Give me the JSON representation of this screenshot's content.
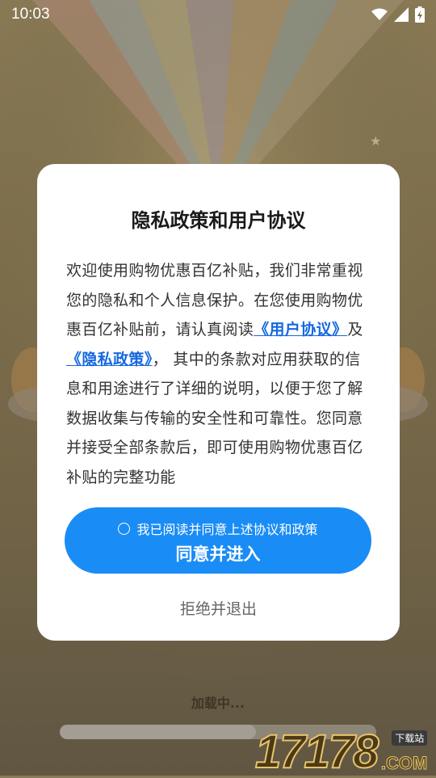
{
  "status_bar": {
    "time": "10:03",
    "icons": [
      "wifi-icon",
      "signal-icon",
      "battery-charging-icon"
    ]
  },
  "dialog": {
    "title": "隐私政策和用户协议",
    "body": {
      "intro": "欢迎使用购物优惠百亿补贴，我们非常重视您的隐私和个人信息保护。在您使用购物优惠百亿补贴前，请认真阅读",
      "user_agreement_link": "《用户协议》",
      "and": "及",
      "privacy_policy_link": "《隐私政策》",
      "rest": "， 其中的条款对应用获取的信息和用途进行了详细的说明，以便于您了解数据收集与传输的安全性和可靠性。您同意并接受全部条款后，即可使用购物优惠百亿补贴的完整功能"
    },
    "agree_checkbox_label": "我已阅读并同意上述协议和政策",
    "agree_button_label": "同意并进入",
    "reject_label": "拒绝并退出"
  },
  "loading": {
    "text": "加载中...",
    "progress": 0.62
  },
  "watermark": {
    "number": "17178",
    "badge": "下载站",
    "suffix": ".COM"
  },
  "colors": {
    "accent": "#1a8cf5",
    "link": "#1668e0"
  }
}
